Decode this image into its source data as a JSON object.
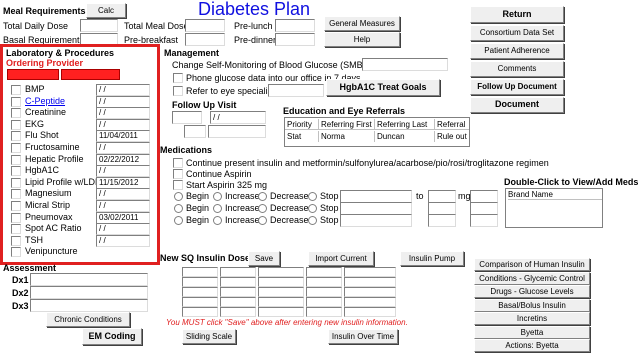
{
  "title": "Diabetes Plan",
  "meal": {
    "heading": "Meal Requirements",
    "calc": "Calc",
    "total_daily_dose": "Total Daily Dose",
    "basal_requirement": "Basal Requirement",
    "total_meal_dose": "Total Meal Dose",
    "pre_breakfast": "Pre-breakfast",
    "pre_lunch": "Pre-lunch",
    "pre_dinner": "Pre-dinner"
  },
  "top_buttons": {
    "general_measures": "General Measures",
    "help": "Help"
  },
  "right_buttons": [
    "Return",
    "Consortium Data Set",
    "Patient Adherence",
    "Comments",
    "Follow Up Document",
    "Document"
  ],
  "lab": {
    "heading": "Laboratory & Procedures",
    "ordering_provider": "Ordering Provider",
    "rows": [
      {
        "name": "BMP",
        "value": " / /",
        "link": false
      },
      {
        "name": "C-Peptide",
        "value": " / /",
        "link": true
      },
      {
        "name": "Creatinine",
        "value": " / /",
        "link": false
      },
      {
        "name": "EKG",
        "value": " / /",
        "link": false
      },
      {
        "name": "Flu Shot",
        "value": "11/04/2011",
        "link": false
      },
      {
        "name": "Fructosamine",
        "value": " / /",
        "link": false
      },
      {
        "name": "Hepatic Profile",
        "value": "02/22/2012",
        "link": false
      },
      {
        "name": "HgbA1C",
        "value": " / /",
        "link": false
      },
      {
        "name": "Lipid Profile w/LDL",
        "value": "11/15/2012",
        "link": false
      },
      {
        "name": "Magnesium",
        "value": " / /",
        "link": false
      },
      {
        "name": "Micral Strip",
        "value": " / /",
        "link": false
      },
      {
        "name": "Pneumovax",
        "value": "03/02/2011",
        "link": false
      },
      {
        "name": "Spot AC Ratio",
        "value": " / /",
        "link": false
      },
      {
        "name": "TSH",
        "value": " / /",
        "link": false
      },
      {
        "name": "Venipuncture",
        "value": "",
        "link": false
      }
    ]
  },
  "management": {
    "heading": "Management",
    "smbg": "Change Self-Monitoring of Blood Glucose (SMBG) to",
    "phone": "Phone glucose data into our office in 7 days",
    "refer": "Refer to eye specialist",
    "hgba1c_button": "HgbA1C Treat Goals"
  },
  "follow_up": {
    "heading": "Follow Up Visit",
    "value": " / /"
  },
  "referrals": {
    "heading": "Education and Eye Referrals",
    "columns": [
      "Priority",
      "Referring First",
      "Referring Last",
      "Referral"
    ],
    "rows": [
      [
        "Stat",
        "Norma",
        "Duncan",
        "Rule out"
      ]
    ]
  },
  "medications": {
    "heading": "Medications",
    "items": [
      "Continue present insulin and metformin/sulfonylurea/acarbose/pio/rosi/troglitazone regimen",
      "Continue Aspirin",
      "Start Aspirin 325 mg"
    ],
    "begin": "Begin",
    "increase": "Increase",
    "decrease": "Decrease",
    "stop": "Stop",
    "to": "to",
    "mg": "mg"
  },
  "meds_panel": {
    "heading": "Double-Click to View/Add Meds",
    "column": "Brand Name"
  },
  "insulin": {
    "heading": "New SQ Insulin Dose",
    "save": "Save",
    "import": "Import Current",
    "pump": "Insulin Pump",
    "warning": "You MUST click \"Save\" above after entering new insulin information.",
    "sliding": "Sliding Scale",
    "over_time": "Insulin Over Time"
  },
  "assessment": {
    "heading": "Assessment",
    "dx1": "Dx1",
    "dx2": "Dx2",
    "dx3": "Dx3",
    "chronic": "Chronic Conditions",
    "em_coding": "EM Coding"
  },
  "reference_buttons": [
    "Comparison of Human Insulin",
    "Conditions - Glycemic Control",
    "Drugs - Glucose Levels",
    "Basal/Bolus Insulin",
    "Incretins",
    "Byetta",
    "Actions: Byetta"
  ],
  "colors": {
    "title": "#1010e0",
    "highlight": "#e02020",
    "ordering_red": "#ff2020",
    "warning": "#e02020",
    "link": "#0000ee"
  }
}
